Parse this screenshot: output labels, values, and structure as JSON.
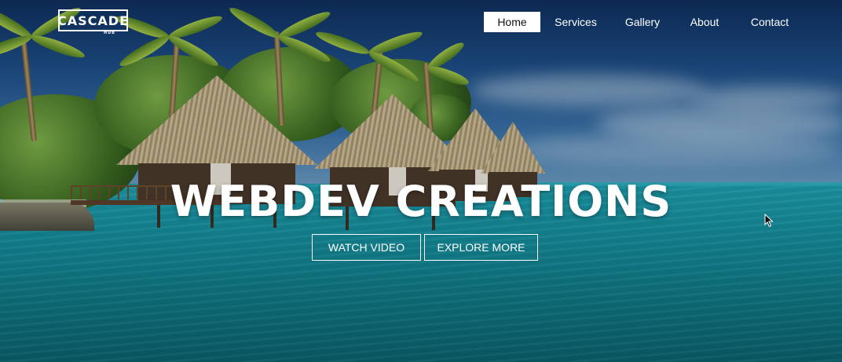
{
  "brand": {
    "logo_text": "CASCADE",
    "logo_sub": "HUB"
  },
  "nav": {
    "items": [
      {
        "label": "Home",
        "active": true
      },
      {
        "label": "Services",
        "active": false
      },
      {
        "label": "Gallery",
        "active": false
      },
      {
        "label": "About",
        "active": false
      },
      {
        "label": "Contact",
        "active": false
      }
    ]
  },
  "hero": {
    "title": "WEBDEV CREATIONS",
    "buttons": [
      {
        "label": "WATCH VIDEO"
      },
      {
        "label": "EXPLORE MORE"
      }
    ],
    "background": "tropical-beach-huts-photo"
  },
  "colors": {
    "text": "#ffffff",
    "active_nav_bg": "#ffffff",
    "active_nav_text": "#111111",
    "sea": "#15909f",
    "sky": "#1d4d86"
  }
}
